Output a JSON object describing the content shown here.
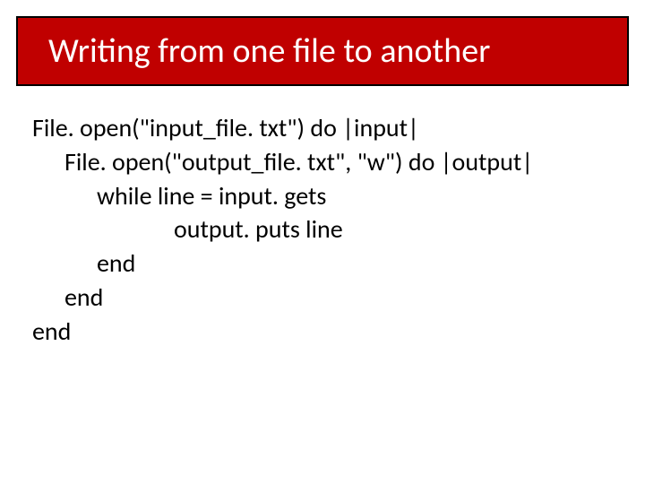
{
  "title": "Writing from one file to another",
  "code": {
    "l1": "File. open(\"input_file. txt\") do |input|",
    "l2": "File. open(\"output_file. txt\", \"w\") do |output|",
    "l3": "while line = input. gets",
    "l4": "output. puts line",
    "l5": "end",
    "l6": "end",
    "l7": "end"
  }
}
